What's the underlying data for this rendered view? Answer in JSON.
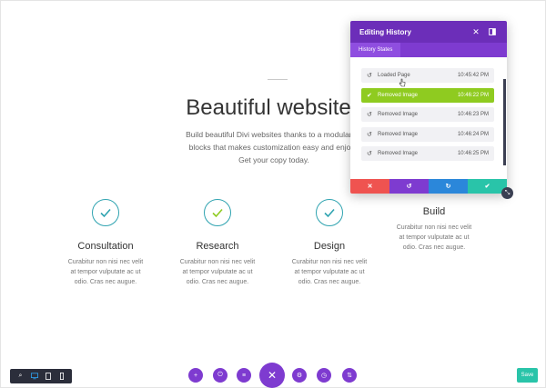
{
  "hero": {
    "title": "Beautiful websites",
    "subtitle_lines": [
      "Build beautiful Divi websites thanks to a modular co",
      "blocks that makes customization easy and enjoya",
      "Get your copy today."
    ]
  },
  "features": [
    {
      "title": "Consultation",
      "lines": [
        "Curabitur non nisi nec velit",
        "at tempor vulputate ac ut",
        "odio. Cras nec augue."
      ]
    },
    {
      "title": "Research",
      "lines": [
        "Curabitur non nisi nec velit",
        "at tempor vulputate ac ut",
        "odio. Cras nec augue."
      ]
    },
    {
      "title": "Design",
      "lines": [
        "Curabitur non nisi nec velit",
        "at tempor vulputate ac ut",
        "odio. Cras nec augue."
      ]
    },
    {
      "title": "Build",
      "lines": [
        "Curabitur non nisi nec velit",
        "at tempor vulputate ac ut",
        "odio. Cras nec augue."
      ]
    }
  ],
  "history_panel": {
    "title": "Editing History",
    "tab_label": "History States",
    "items": [
      {
        "label": "Loaded Page",
        "time": "10:45:42 PM",
        "active": false,
        "icon": "undo-icon"
      },
      {
        "label": "Removed Image",
        "time": "10:46:22 PM",
        "active": true,
        "icon": "check-icon"
      },
      {
        "label": "Removed Image",
        "time": "10:46:23 PM",
        "active": false,
        "icon": "undo-icon"
      },
      {
        "label": "Removed Image",
        "time": "10:46:24 PM",
        "active": false,
        "icon": "undo-icon"
      },
      {
        "label": "Removed Image",
        "time": "10:46:25 PM",
        "active": false,
        "icon": "undo-icon"
      }
    ],
    "footer_buttons": [
      {
        "name": "discard",
        "icon": "close-icon",
        "color": "#ef5350"
      },
      {
        "name": "undo",
        "icon": "undo-icon",
        "color": "#7e3bd0"
      },
      {
        "name": "redo",
        "icon": "redo-icon",
        "color": "#2b87da"
      },
      {
        "name": "apply",
        "icon": "check-icon",
        "color": "#29c4a9"
      }
    ]
  },
  "toolbar": {
    "save_label": "Save"
  },
  "colors": {
    "purple": "#6c2eb9",
    "green_active": "#8fcb20",
    "teal": "#2ea3b0",
    "save": "#29c4a9"
  }
}
